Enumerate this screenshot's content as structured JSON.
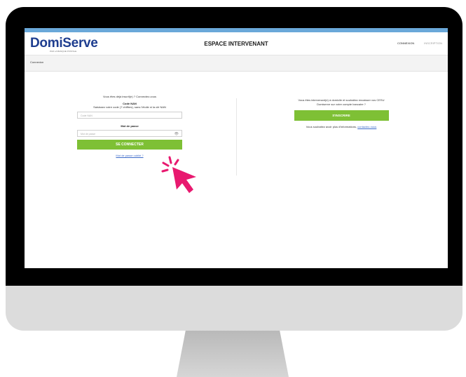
{
  "brand": {
    "logo": "DomiServe",
    "tagline": "PAR LA BANQUE POSTALE"
  },
  "header": {
    "title": "ESPACE INTERVENANT",
    "nav_login": "CONNEXION",
    "nav_signup": "INSCRIPTION"
  },
  "breadcrumb": "Connexion",
  "login": {
    "prompt": "Vous êtes déjà inscrit(e) ? Connectez-vous",
    "code_label": "Code NAN",
    "code_help": "Saisissez votre code (7 chiffres), sans l'étoile ni la clé NAN",
    "code_placeholder": "Code NAN",
    "password_label": "Mot de passe",
    "password_placeholder": "Mot de passe",
    "submit": "SE CONNECTER",
    "forgot": "Mot de passe oublié ?"
  },
  "signup": {
    "text": "Vous êtes intervenant(e) à domicile et souhaitez encaisser vos CESU Domiserve sur votre compte bancaire ?",
    "button": "S'INSCRIRE",
    "info": "Vous souhaitez avoir plus d'informations,",
    "contact_link": "contactez-nous"
  },
  "colors": {
    "accent": "#7ec035",
    "brand": "#1e3d8f",
    "topbar": "#6aa8d9",
    "cursor": "#e8196f"
  },
  "icons": {
    "eye": "eye-icon",
    "cursor": "hand-cursor-icon"
  }
}
